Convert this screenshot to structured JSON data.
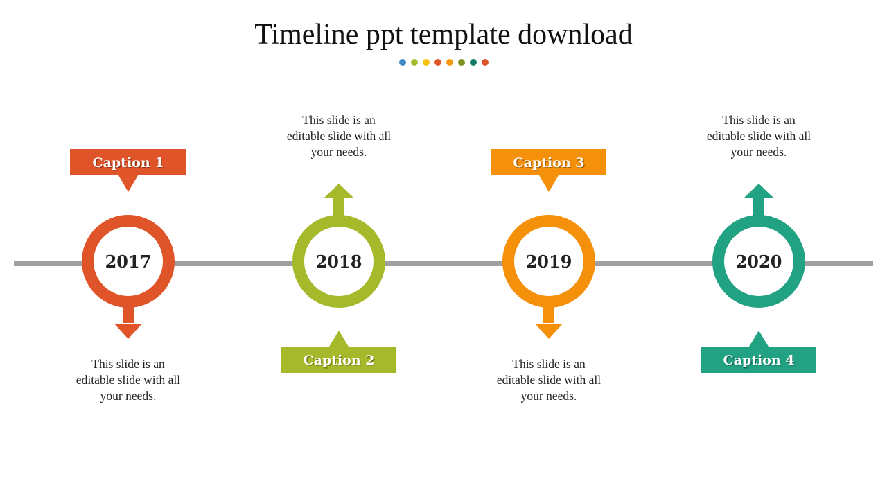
{
  "title": "Timeline ppt template download",
  "decor_dots": [
    "#3f8ac4",
    "#a6bb2a",
    "#f7c010",
    "#e0542a",
    "#f59a0c",
    "#7e8f23",
    "#167b66",
    "#e0542a"
  ],
  "timeline": {
    "bar_color": "#a0a0a0",
    "nodes": [
      {
        "year": "2017",
        "caption": "Caption  1",
        "color": "#e0542a",
        "caption_position": "top",
        "arrow_direction": "down",
        "description": "This slide is an editable slide with all your needs.",
        "description_lines": [
          "This slide is an",
          "editable slide with all",
          "your needs."
        ]
      },
      {
        "year": "2018",
        "caption": "Caption  2",
        "color": "#a6b92a",
        "caption_position": "bottom",
        "arrow_direction": "up",
        "description": "This slide is an editable slide with all your needs.",
        "description_lines": [
          "This slide is an",
          "editable slide with all",
          "your needs."
        ]
      },
      {
        "year": "2019",
        "caption": "Caption  3",
        "color": "#f5900a",
        "caption_position": "top",
        "arrow_direction": "down",
        "description": "This slide is an editable slide with all your needs.",
        "description_lines": [
          "This slide is an",
          "editable slide with all",
          "your needs."
        ]
      },
      {
        "year": "2020",
        "caption": "Caption  4",
        "color": "#21a283",
        "caption_position": "bottom",
        "arrow_direction": "up",
        "description": "This slide is an editable slide with all your needs.",
        "description_lines": [
          "This slide is an",
          "editable slide with all",
          "your needs."
        ]
      }
    ]
  }
}
